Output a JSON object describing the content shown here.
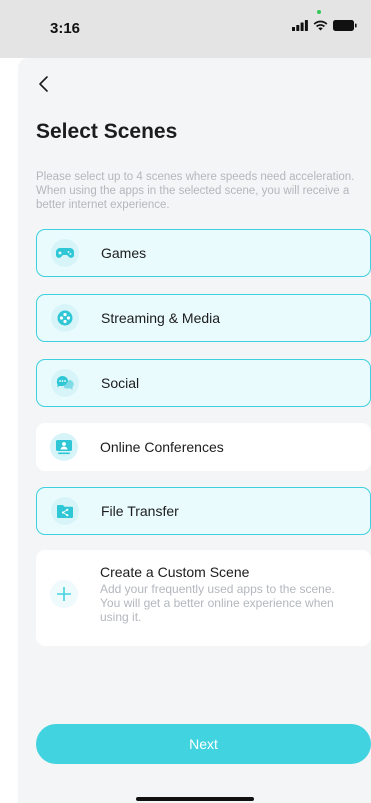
{
  "status_bar": {
    "time": "3:16"
  },
  "page": {
    "title": "Select Scenes",
    "description": "Please select up to 4 scenes where speeds need acceleration. When using the apps in the selected scene, you will receive a better internet experience."
  },
  "scenes": [
    {
      "label": "Games",
      "selected": true,
      "icon": "gamepad-icon"
    },
    {
      "label": "Streaming & Media",
      "selected": true,
      "icon": "film-reel-icon"
    },
    {
      "label": "Social",
      "selected": true,
      "icon": "chat-bubbles-icon"
    },
    {
      "label": "Online Conferences",
      "selected": false,
      "icon": "monitor-person-icon"
    },
    {
      "label": "File Transfer",
      "selected": true,
      "icon": "folder-share-icon"
    }
  ],
  "custom_scene": {
    "title": "Create a Custom Scene",
    "description": "Add your frequently used apps to the scene. You will get a better online experience when using it.",
    "icon": "plus-icon"
  },
  "next_button": {
    "label": "Next"
  },
  "colors": {
    "accent": "#41d3e0",
    "selected_border": "#3ed0de",
    "selected_bg": "#e9fbfd",
    "sheet_bg": "#f4f5f6"
  }
}
